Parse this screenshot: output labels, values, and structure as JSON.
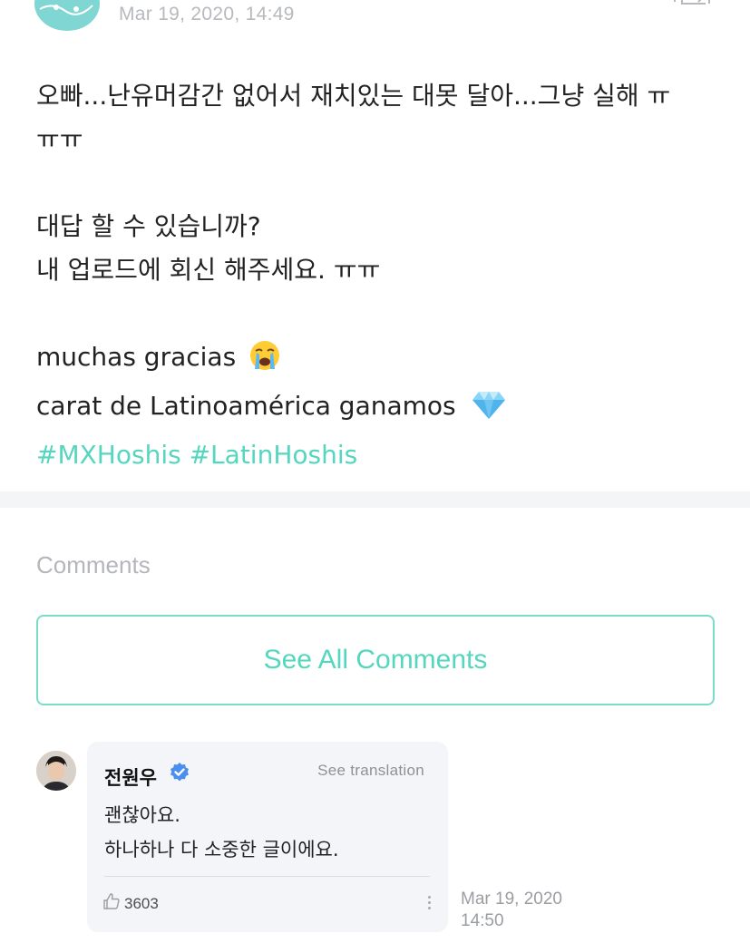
{
  "post": {
    "date": "Mar 19, 2020, 14:49",
    "lines": [
      "오빠...난유머감간 없어서 재치있는 대못 달아...그냥 실해 ㅠ",
      "ㅠㅠ",
      "",
      "대답 할 수 있습니까?",
      "내 업로드에 회신 해주세요. ㅠㅠ",
      "",
      "muchas gracias",
      "carat de Latinoamérica  ganamos"
    ],
    "emojis": [
      "loudly-crying-face",
      "gem-stone"
    ],
    "hashtags": [
      "#MXHoshis",
      "#LatinHoshis"
    ]
  },
  "comments_section": {
    "heading": "Comments",
    "see_all_label": "See All Comments"
  },
  "comment": {
    "author": "전원우",
    "verified": true,
    "translate_label": "See translation",
    "lines": [
      "괜찮아요.",
      "하나하나 다 소중한 글이에요."
    ],
    "likes": "3603",
    "date_line1": "Mar 19, 2020",
    "date_line2": "14:50"
  },
  "colors": {
    "accent": "#55d6be",
    "muted": "#b6b9bd",
    "bubble": "#f4f5f8",
    "verified": "#4a8ff0"
  },
  "icons": [
    "author-avatar",
    "translate-icon",
    "verified-badge-icon",
    "thumbs-up-icon",
    "more-options-icon"
  ]
}
